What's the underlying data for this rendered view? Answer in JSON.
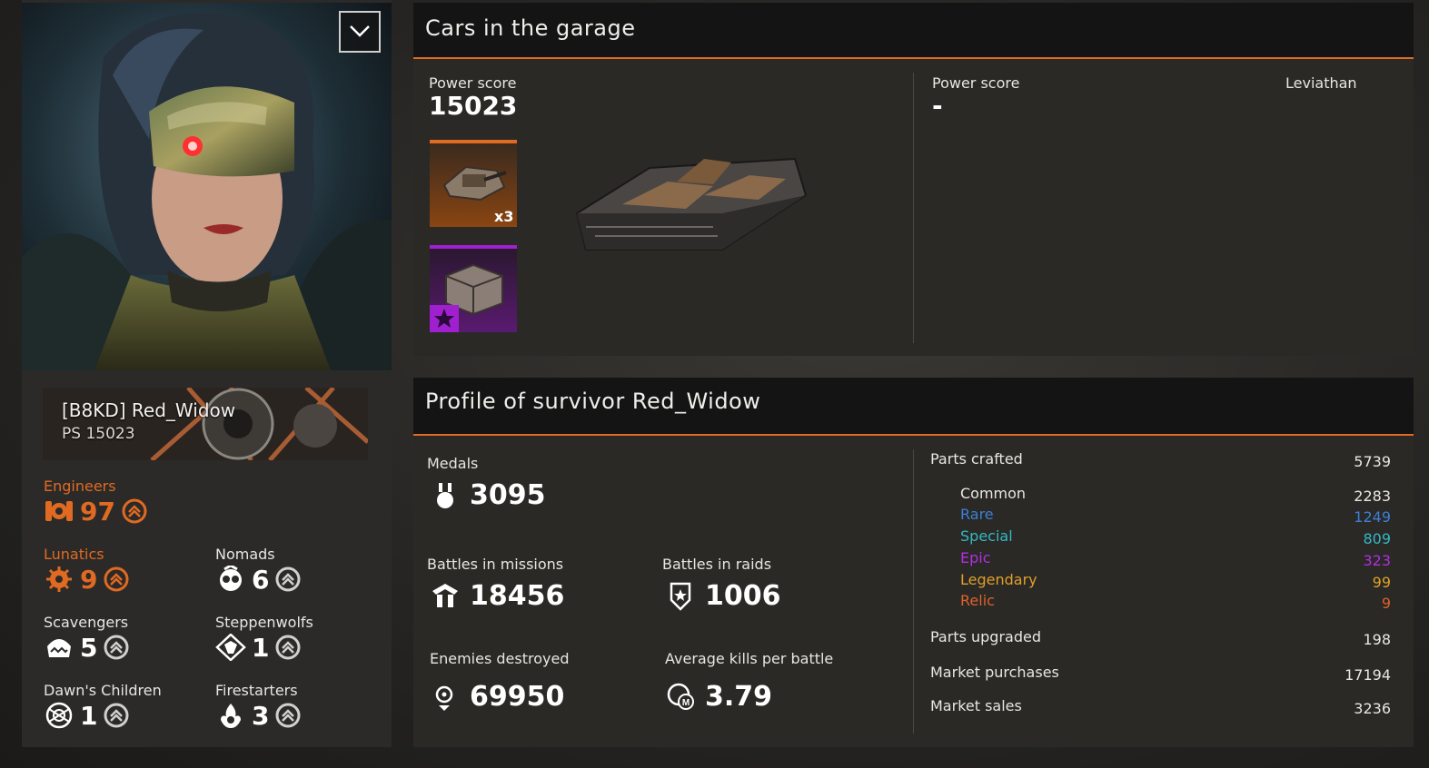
{
  "player": {
    "banner_name": "[B8KD] Red_Widow",
    "banner_ps": "PS 15023"
  },
  "factions": [
    {
      "name": "Engineers",
      "level": "97",
      "highlight": true,
      "icon": "engineers-icon"
    },
    {
      "name": "Lunatics",
      "level": "9",
      "highlight": true,
      "icon": "lunatics-icon"
    },
    {
      "name": "Nomads",
      "level": "6",
      "highlight": false,
      "icon": "nomads-icon"
    },
    {
      "name": "Scavengers",
      "level": "5",
      "highlight": false,
      "icon": "scavengers-icon"
    },
    {
      "name": "Steppenwolfs",
      "level": "1",
      "highlight": false,
      "icon": "steppenwolfs-icon"
    },
    {
      "name": "Dawn's Children",
      "level": "1",
      "highlight": false,
      "icon": "dawns-children-icon"
    },
    {
      "name": "Firestarters",
      "level": "3",
      "highlight": false,
      "icon": "firestarters-icon"
    }
  ],
  "garage": {
    "title": "Cars in the garage",
    "car1": {
      "power_label": "Power score",
      "power_value": "15023",
      "slot1_count": "x3"
    },
    "car2": {
      "power_label": "Power score",
      "power_value": "-",
      "name": "Leviathan"
    }
  },
  "profile": {
    "title": "Profile of survivor Red_Widow",
    "medals_label": "Medals",
    "medals_value": "3095",
    "battles_missions_label": "Battles in missions",
    "battles_missions_value": "18456",
    "battles_raids_label": "Battles in raids",
    "battles_raids_value": "1006",
    "enemies_label": "Enemies destroyed",
    "enemies_value": "69950",
    "avg_kills_label": "Average kills per battle",
    "avg_kills_value": "3.79",
    "parts_crafted_label": "Parts crafted",
    "parts_crafted_value": "5739",
    "rarities": [
      {
        "name": "Common",
        "value": "2283",
        "color": "#e8e6e2"
      },
      {
        "name": "Rare",
        "value": "1249",
        "color": "#3d7fd6"
      },
      {
        "name": "Special",
        "value": "809",
        "color": "#33b8c4"
      },
      {
        "name": "Epic",
        "value": "323",
        "color": "#b42ee0"
      },
      {
        "name": "Legendary",
        "value": "99",
        "color": "#e0a02a"
      },
      {
        "name": "Relic",
        "value": "9",
        "color": "#e0602a"
      }
    ],
    "parts_upgraded_label": "Parts upgraded",
    "parts_upgraded_value": "198",
    "market_purchases_label": "Market purchases",
    "market_purchases_value": "17194",
    "market_sales_label": "Market sales",
    "market_sales_value": "3236"
  },
  "colors": {
    "accent": "#e06a22",
    "header_bg": "#141414",
    "panel_bg": "#2a2926"
  }
}
